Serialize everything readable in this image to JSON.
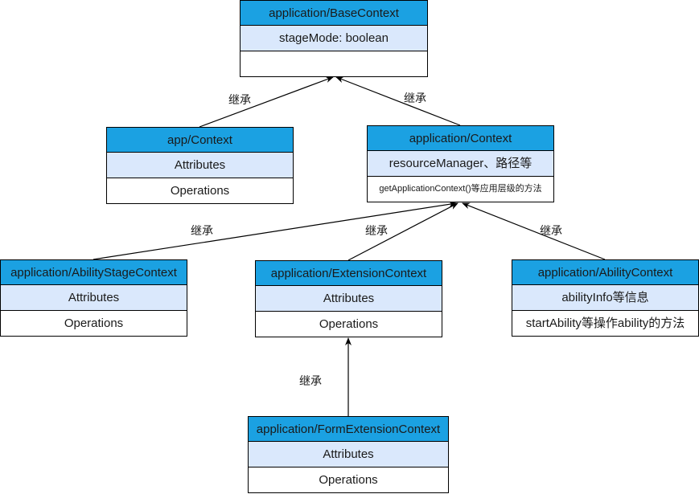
{
  "diagram": {
    "type": "uml-class-inheritance",
    "edge_label": "继承",
    "colors": {
      "header_fill": "#1ba1e2",
      "attribute_fill": "#dae8fc",
      "operation_fill": "#ffffff",
      "stroke": "#000000"
    },
    "classes": {
      "base_context": {
        "name": "application/BaseContext",
        "attributes": "stageMode: boolean",
        "operations": ""
      },
      "app_context": {
        "name": "app/Context",
        "attributes": "Attributes",
        "operations": "Operations"
      },
      "application_context": {
        "name": "application/Context",
        "attributes": "resourceManager、路径等",
        "operations": "getApplicationContext()等应用层级的方法"
      },
      "ability_stage_context": {
        "name": "application/AbilityStageContext",
        "attributes": "Attributes",
        "operations": "Operations"
      },
      "extension_context": {
        "name": "application/ExtensionContext",
        "attributes": "Attributes",
        "operations": "Operations"
      },
      "ability_context": {
        "name": "application/AbilityContext",
        "attributes": "abilityInfo等信息",
        "operations": "startAbility等操作ability的方法"
      },
      "form_extension_context": {
        "name": "application/FormExtensionContext",
        "attributes": "Attributes",
        "operations": "Operations"
      }
    },
    "edges": [
      {
        "from": "app/Context",
        "to": "application/BaseContext",
        "label": "继承"
      },
      {
        "from": "application/Context",
        "to": "application/BaseContext",
        "label": "继承"
      },
      {
        "from": "application/AbilityStageContext",
        "to": "application/Context",
        "label": "继承"
      },
      {
        "from": "application/ExtensionContext",
        "to": "application/Context",
        "label": "继承"
      },
      {
        "from": "application/AbilityContext",
        "to": "application/Context",
        "label": "继承"
      },
      {
        "from": "application/FormExtensionContext",
        "to": "application/ExtensionContext",
        "label": "继承"
      }
    ]
  }
}
